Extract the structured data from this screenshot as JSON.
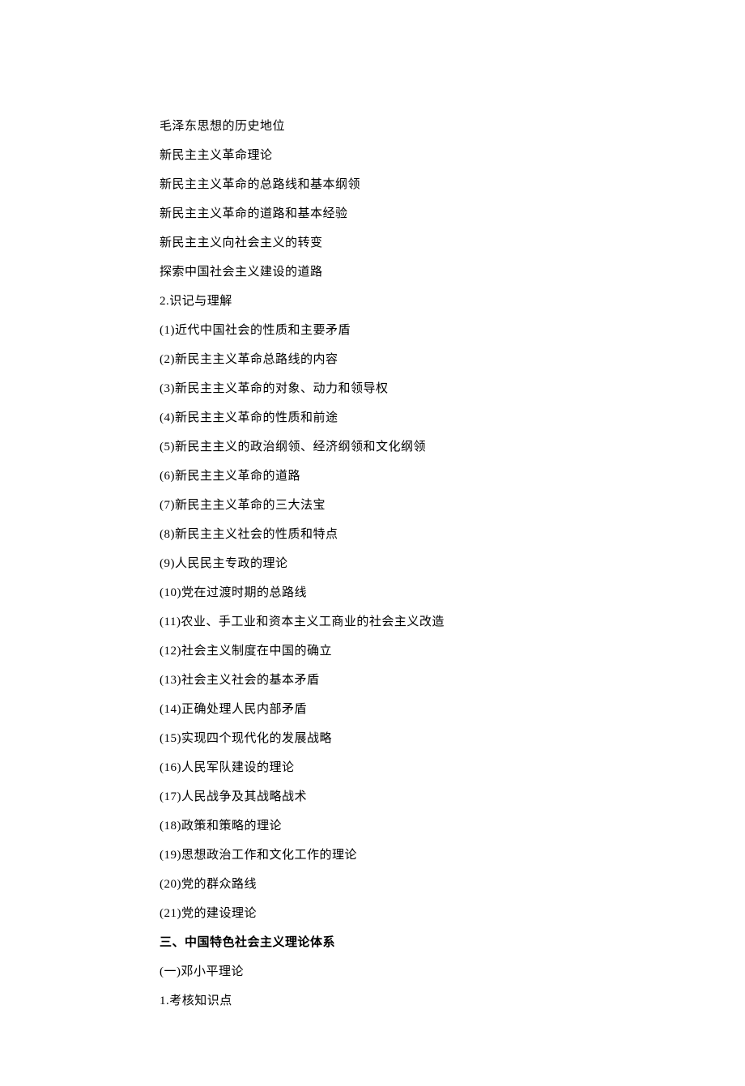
{
  "lines": [
    {
      "text": "毛泽东思想的历史地位",
      "bold": false
    },
    {
      "text": "新民主主义革命理论",
      "bold": false
    },
    {
      "text": "新民主主义革命的总路线和基本纲领",
      "bold": false
    },
    {
      "text": "新民主主义革命的道路和基本经验",
      "bold": false
    },
    {
      "text": "新民主主义向社会主义的转变",
      "bold": false
    },
    {
      "text": "探索中国社会主义建设的道路",
      "bold": false
    },
    {
      "text": "2.识记与理解",
      "bold": false
    },
    {
      "text": "(1)近代中国社会的性质和主要矛盾",
      "bold": false
    },
    {
      "text": "(2)新民主主义革命总路线的内容",
      "bold": false
    },
    {
      "text": "(3)新民主主义革命的对象、动力和领导权",
      "bold": false
    },
    {
      "text": "(4)新民主主义革命的性质和前途",
      "bold": false
    },
    {
      "text": "(5)新民主主义的政治纲领、经济纲领和文化纲领",
      "bold": false
    },
    {
      "text": "(6)新民主主义革命的道路",
      "bold": false
    },
    {
      "text": "(7)新民主主义革命的三大法宝",
      "bold": false
    },
    {
      "text": "(8)新民主主义社会的性质和特点",
      "bold": false
    },
    {
      "text": "(9)人民民主专政的理论",
      "bold": false
    },
    {
      "text": "(10)党在过渡时期的总路线",
      "bold": false
    },
    {
      "text": "(11)农业、手工业和资本主义工商业的社会主义改造",
      "bold": false
    },
    {
      "text": "(12)社会主义制度在中国的确立",
      "bold": false
    },
    {
      "text": "(13)社会主义社会的基本矛盾",
      "bold": false
    },
    {
      "text": "(14)正确处理人民内部矛盾",
      "bold": false
    },
    {
      "text": "(15)实现四个现代化的发展战略",
      "bold": false
    },
    {
      "text": "(16)人民军队建设的理论",
      "bold": false
    },
    {
      "text": "(17)人民战争及其战略战术",
      "bold": false
    },
    {
      "text": "(18)政策和策略的理论",
      "bold": false
    },
    {
      "text": "(19)思想政治工作和文化工作的理论",
      "bold": false
    },
    {
      "text": "(20)党的群众路线",
      "bold": false
    },
    {
      "text": "(21)党的建设理论",
      "bold": false
    },
    {
      "text": "三、中国特色社会主义理论体系",
      "bold": true
    },
    {
      "text": "(一)邓小平理论",
      "bold": false
    },
    {
      "text": "1.考核知识点",
      "bold": false
    }
  ]
}
